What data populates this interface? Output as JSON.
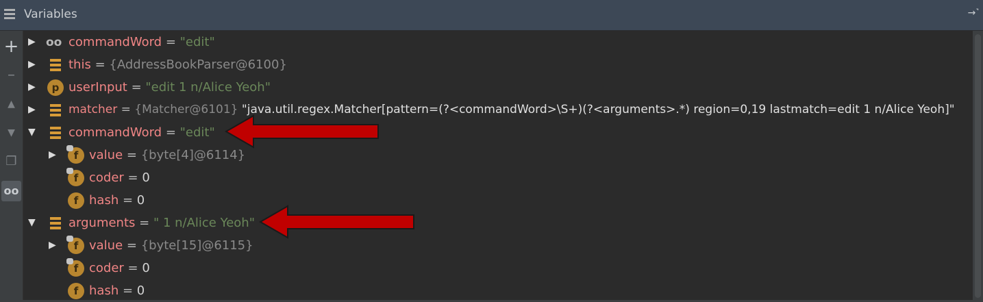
{
  "panel": {
    "title": "Variables"
  },
  "toolbar": {
    "items": [
      "add",
      "remove",
      "up",
      "down",
      "copy",
      "watches"
    ]
  },
  "rows": [
    {
      "expander": "▶",
      "icon": "glasses-icon",
      "name": "commandWord",
      "eq": " = ",
      "value": "\"edit\""
    },
    {
      "expander": "▶",
      "icon": "list-icon",
      "name": "this",
      "eq": " = ",
      "value": "{AddressBookParser@6100}"
    },
    {
      "expander": "▶",
      "icon": "p-icon",
      "icon_letter": "p",
      "name": "userInput",
      "eq": " = ",
      "value": "\"edit 1 n/Alice Yeoh\""
    },
    {
      "expander": "▶",
      "icon": "list-icon",
      "name": "matcher",
      "eq": " = ",
      "ref": "{Matcher@6101} ",
      "value": "\"java.util.regex.Matcher[pattern=(?<commandWord>\\S+)(?<arguments>.*) region=0,19 lastmatch=edit 1 n/Alice Yeoh]\""
    },
    {
      "expander": "▼",
      "icon": "list-icon",
      "name": "commandWord",
      "eq": " = ",
      "value": "\"edit\""
    },
    {
      "expander": "▶",
      "icon": "f-icon",
      "icon_letter": "f",
      "name": "value",
      "eq": " = ",
      "value": "{byte[4]@6114}"
    },
    {
      "expander": "",
      "icon": "f-icon",
      "icon_letter": "f",
      "name": "coder",
      "eq": " = ",
      "value": "0"
    },
    {
      "expander": "",
      "icon": "f-icon",
      "icon_letter": "f",
      "name": "hash",
      "eq": " = ",
      "value": "0"
    },
    {
      "expander": "▼",
      "icon": "list-icon",
      "name": "arguments",
      "eq": " = ",
      "value": "\" 1 n/Alice Yeoh\""
    },
    {
      "expander": "▶",
      "icon": "f-icon",
      "icon_letter": "f",
      "name": "value",
      "eq": " = ",
      "value": "{byte[15]@6115}"
    },
    {
      "expander": "",
      "icon": "f-icon",
      "icon_letter": "f",
      "name": "coder",
      "eq": " = ",
      "value": "0"
    },
    {
      "expander": "",
      "icon": "f-icon",
      "icon_letter": "f",
      "name": "hash",
      "eq": " = ",
      "value": "0"
    }
  ],
  "colors": {
    "annotation_arrow": "#c00000"
  }
}
